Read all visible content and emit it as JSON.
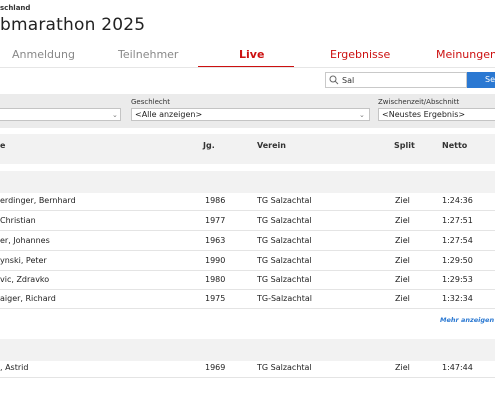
{
  "header": {
    "subtitle": "schland",
    "title": "bmarathon 2025"
  },
  "tabs": [
    {
      "label": "Anmeldung"
    },
    {
      "label": "Teilnehmer"
    },
    {
      "label": "Live"
    },
    {
      "label": "Ergebnisse"
    },
    {
      "label": "Meinungen"
    }
  ],
  "search": {
    "value": "Sal",
    "button_label": "Se"
  },
  "filters": {
    "gender_label": "Geschlecht",
    "gender_value": "<Alle anzeigen>",
    "split_label": "Zwischenzeit/Abschnitt",
    "split_value": "<Neustes Ergebnis>"
  },
  "table": {
    "headers": {
      "name": "e",
      "year": "Jg.",
      "club": "Verein",
      "split": "Split",
      "net": "Netto"
    },
    "group1_rows": [
      {
        "name": "erdinger, Bernhard",
        "year": "1986",
        "club": "TG Salzachtal",
        "split": "Ziel",
        "net": "1:24:36"
      },
      {
        "name": "Christian",
        "year": "1977",
        "club": "TG Salzachtal",
        "split": "Ziel",
        "net": "1:27:51"
      },
      {
        "name": "er, Johannes",
        "year": "1963",
        "club": "TG Salzachtal",
        "split": "Ziel",
        "net": "1:27:54"
      },
      {
        "name": "ynski, Peter",
        "year": "1990",
        "club": "TG Salzachtal",
        "split": "Ziel",
        "net": "1:29:50"
      },
      {
        "name": "vic, Zdravko",
        "year": "1980",
        "club": "TG Salzachtal",
        "split": "Ziel",
        "net": "1:29:53"
      },
      {
        "name": "aiger, Richard",
        "year": "1975",
        "club": "TG-Salzachtal",
        "split": "Ziel",
        "net": "1:32:34"
      }
    ],
    "more_label": "Mehr anzeigen",
    "group2_rows": [
      {
        "name": ", Astrid",
        "year": "1969",
        "club": "TG Salzachtal",
        "split": "Ziel",
        "net": "1:47:44"
      }
    ]
  }
}
